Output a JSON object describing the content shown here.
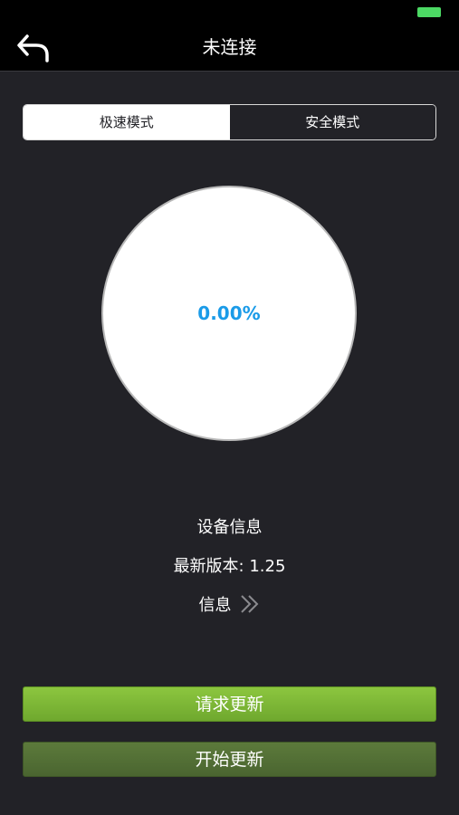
{
  "nav": {
    "title": "未连接",
    "back_icon": "back-arrow-icon"
  },
  "mode_tabs": [
    {
      "label": "极速模式",
      "selected": true
    },
    {
      "label": "安全模式",
      "selected": false
    }
  ],
  "progress": {
    "text": "0.00%",
    "value": 0.0
  },
  "device": {
    "heading": "设备信息",
    "latest_version": "最新版本: 1.25",
    "info_link": "信息",
    "info_icon": "double-chevron-right-icon"
  },
  "buttons": {
    "request_update": "请求更新",
    "start_update": "开始更新"
  },
  "colors": {
    "progress_text": "#1a9be8",
    "battery": "#4cd964",
    "request_button": "#8cc63f",
    "start_button": "#5c7a3b"
  }
}
